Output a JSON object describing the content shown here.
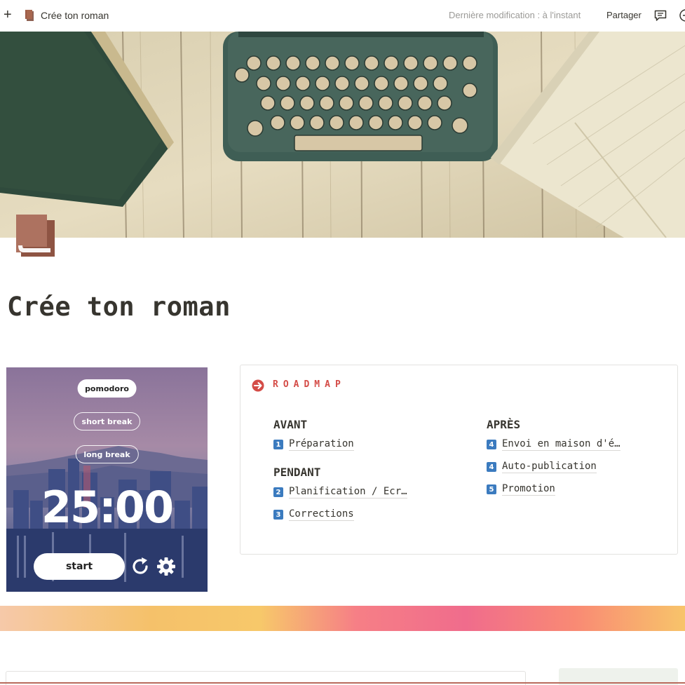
{
  "topbar": {
    "page_title": "Crée ton roman",
    "last_modified": "Dernière modification : à l'instant",
    "share_label": "Partager"
  },
  "page": {
    "title": "Crée ton roman",
    "icon_color": "#9a5a47"
  },
  "pomodoro": {
    "modes": [
      "pomodoro",
      "short break",
      "long break"
    ],
    "active_mode": "pomodoro",
    "time": "25:00",
    "start_label": "start"
  },
  "roadmap": {
    "title": "ROADMAP",
    "accent_color": "#d44c47",
    "left_sections": [
      {
        "heading": "AVANT",
        "items": [
          {
            "num": "1",
            "label": "Préparation"
          }
        ]
      },
      {
        "heading": "PENDANT",
        "items": [
          {
            "num": "2",
            "label": "Planification / Ecr…"
          },
          {
            "num": "3",
            "label": "Corrections"
          }
        ]
      }
    ],
    "right_sections": [
      {
        "heading": "APRÈS",
        "items": [
          {
            "num": "4",
            "label": "Envoi en maison d'é…"
          },
          {
            "num": "4",
            "label": "Auto-publication"
          },
          {
            "num": "5",
            "label": "Promotion"
          }
        ]
      }
    ]
  }
}
